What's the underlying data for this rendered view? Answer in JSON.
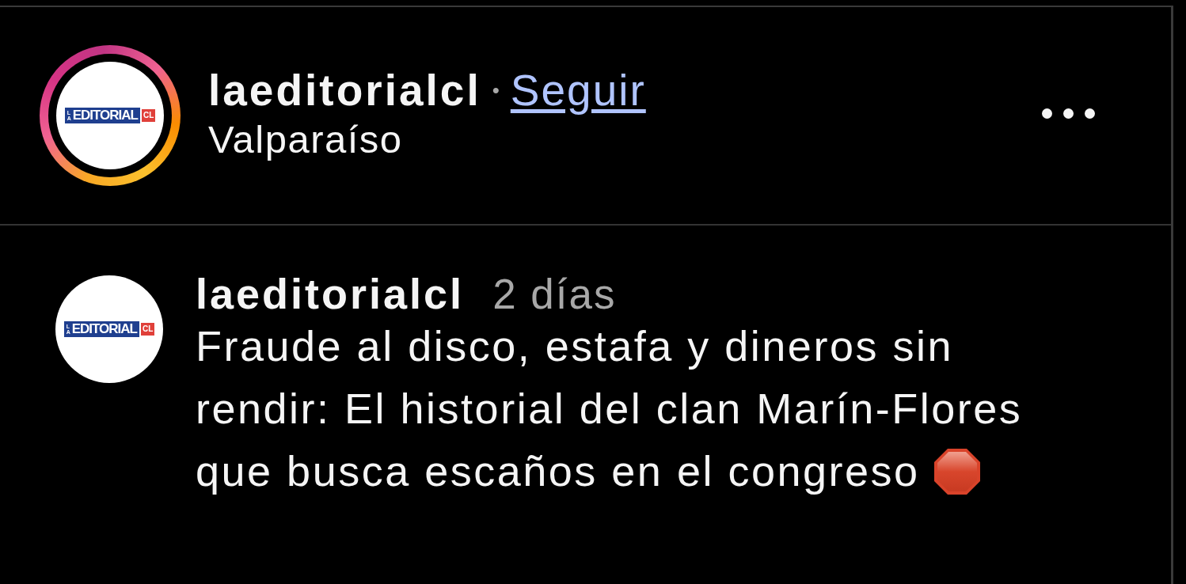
{
  "header": {
    "avatar": {
      "story_ring": true,
      "logo_prefix": "LA",
      "logo_name": "EDITORIAL",
      "logo_badge": "CL"
    },
    "username": "laeditorialcl",
    "separator": "•",
    "follow_link": "Seguir",
    "location": "Valparaíso"
  },
  "comment": {
    "avatar": {
      "story_ring": false,
      "logo_prefix": "LA",
      "logo_name": "EDITORIAL",
      "logo_badge": "CL"
    },
    "username": "laeditorialcl",
    "time": "2 días",
    "text": "Fraude al disco, estafa y dineros sin rendir: El historial del clan Marín-Flores que busca escaños en el congreso"
  }
}
